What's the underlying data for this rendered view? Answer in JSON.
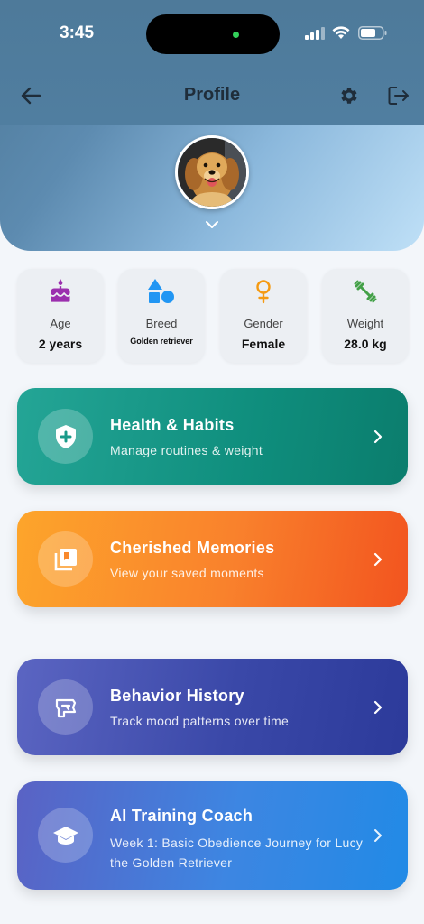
{
  "status_bar": {
    "time": "3:45"
  },
  "navbar": {
    "title": "Profile"
  },
  "stats": [
    {
      "icon": "cake-icon",
      "label": "Age",
      "value": "2 years",
      "color": "#9b2fae"
    },
    {
      "icon": "shapes-icon",
      "label": "Breed",
      "value": "Golden retriever",
      "color": "#2196f3"
    },
    {
      "icon": "female-icon",
      "label": "Gender",
      "value": "Female",
      "color": "#f59a12"
    },
    {
      "icon": "dumbbell-icon",
      "label": "Weight",
      "value": "28.0 kg",
      "color": "#43a047"
    }
  ],
  "cards": [
    {
      "icon": "shield-plus-icon",
      "title": "Health & Habits",
      "subtitle": "Manage routines & weight"
    },
    {
      "icon": "photo-library-icon",
      "title": "Cherished Memories",
      "subtitle": "View your saved moments"
    },
    {
      "icon": "psychology-icon",
      "title": "Behavior History",
      "subtitle": "Track mood patterns over time"
    },
    {
      "icon": "graduation-cap-icon",
      "title": "AI Training Coach",
      "subtitle": "Week 1: Basic Obedience Journey for Lucy the Golden Retriever"
    }
  ]
}
